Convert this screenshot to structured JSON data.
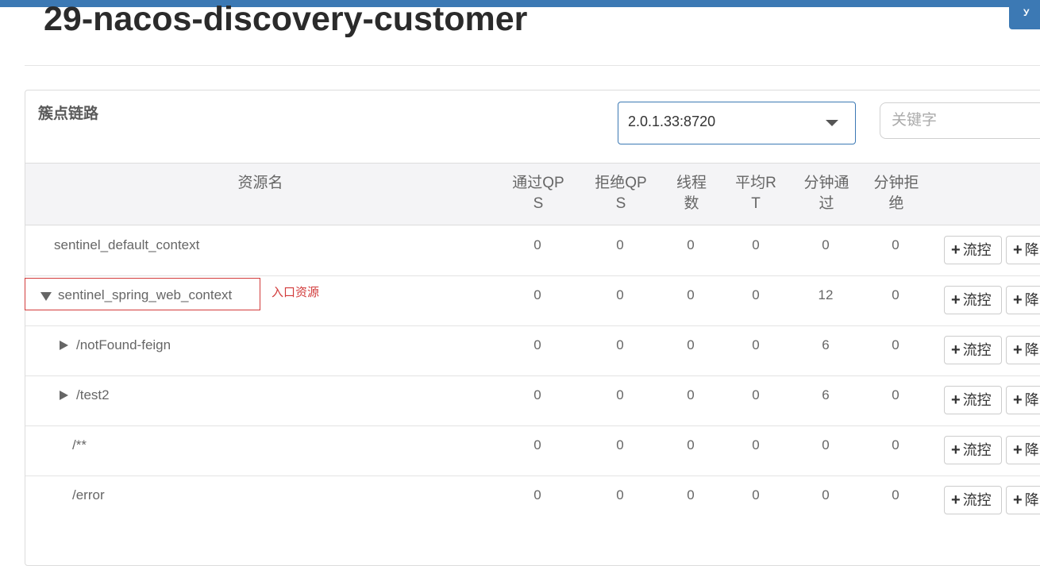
{
  "app": {
    "title": "29-nacos-discovery-customer",
    "corner_button": "У"
  },
  "panel": {
    "heading": "簇点链路",
    "machine_select": {
      "value": "2.0.1.33:8720"
    },
    "search": {
      "placeholder": "关键字",
      "value": ""
    }
  },
  "table": {
    "headers": {
      "name": "资源名",
      "pass_qps": [
        "通过QP",
        "S"
      ],
      "block_qps": [
        "拒绝QP",
        "S"
      ],
      "threads": [
        "线程",
        "数"
      ],
      "avg_rt": [
        "平均R",
        "T"
      ],
      "minute_pass": [
        "分钟通",
        "过"
      ],
      "minute_block": [
        "分钟拒",
        "绝"
      ]
    },
    "rows": [
      {
        "name": "sentinel_default_context",
        "pass_qps": "0",
        "block_qps": "0",
        "threads": "0",
        "avg_rt": "0",
        "minute_pass": "0",
        "minute_block": "0",
        "flow_button": "流控",
        "degrade_button": "降"
      },
      {
        "name": "sentinel_spring_web_context",
        "pass_qps": "0",
        "block_qps": "0",
        "threads": "0",
        "avg_rt": "0",
        "minute_pass": "12",
        "minute_block": "0",
        "flow_button": "流控",
        "degrade_button": "降"
      },
      {
        "name": "/notFound-feign",
        "pass_qps": "0",
        "block_qps": "0",
        "threads": "0",
        "avg_rt": "0",
        "minute_pass": "6",
        "minute_block": "0",
        "flow_button": "流控",
        "degrade_button": "降"
      },
      {
        "name": "/test2",
        "pass_qps": "0",
        "block_qps": "0",
        "threads": "0",
        "avg_rt": "0",
        "minute_pass": "6",
        "minute_block": "0",
        "flow_button": "流控",
        "degrade_button": "降"
      },
      {
        "name": "/**",
        "pass_qps": "0",
        "block_qps": "0",
        "threads": "0",
        "avg_rt": "0",
        "minute_pass": "0",
        "minute_block": "0",
        "flow_button": "流控",
        "degrade_button": "降"
      },
      {
        "name": "/error",
        "pass_qps": "0",
        "block_qps": "0",
        "threads": "0",
        "avg_rt": "0",
        "minute_pass": "0",
        "minute_block": "0",
        "flow_button": "流控",
        "degrade_button": "降"
      }
    ]
  },
  "annotation": {
    "text": "入口资源",
    "color": "#d23b3b"
  },
  "colors": {
    "brand": "#3c79b4",
    "header_bg": "#f4f4f6"
  },
  "icons": {
    "expanded": "caret-down-icon",
    "collapsed": "caret-right-icon",
    "add": "plus-icon"
  }
}
